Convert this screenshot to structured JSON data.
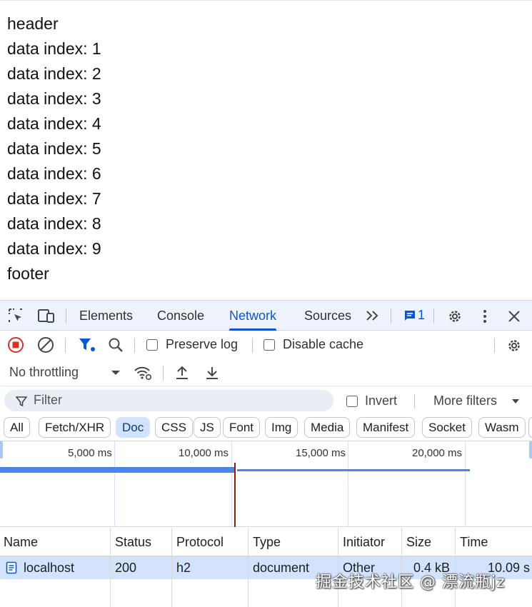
{
  "page": {
    "lines": [
      "header",
      "data index: 1",
      "data index: 2",
      "data index: 3",
      "data index: 4",
      "data index: 5",
      "data index: 6",
      "data index: 7",
      "data index: 8",
      "data index: 9",
      "footer"
    ]
  },
  "devtools": {
    "tabs": [
      "Elements",
      "Console",
      "Network",
      "Sources"
    ],
    "active_tab": "Network",
    "issues_count": "1",
    "toolbar": {
      "preserve_log": "Preserve log",
      "disable_cache": "Disable cache",
      "throttling": "No throttling"
    },
    "filter": {
      "placeholder": "Filter",
      "invert": "Invert",
      "more_filters": "More filters"
    },
    "chips": [
      "All",
      "Fetch/XHR",
      "Doc",
      "CSS",
      "JS",
      "Font",
      "Img",
      "Media",
      "Manifest",
      "Socket",
      "Wasm"
    ],
    "selected_chip": "Doc",
    "timeline_ticks": [
      "5,000 ms",
      "10,000 ms",
      "15,000 ms",
      "20,000 ms"
    ],
    "table": {
      "headers": [
        "Name",
        "Status",
        "Protocol",
        "Type",
        "Initiator",
        "Size",
        "Time"
      ],
      "rows": [
        {
          "name": "localhost",
          "status": "200",
          "protocol": "h2",
          "type": "document",
          "initiator": "Other",
          "size": "0.4 kB",
          "time": "10.09 s"
        }
      ]
    },
    "colors": {
      "accent": "#0b57d0",
      "selected_row": "#d3e3fd",
      "record": "#d93025"
    }
  },
  "watermark": "掘金技术社区 @ 漂流瓶jz"
}
